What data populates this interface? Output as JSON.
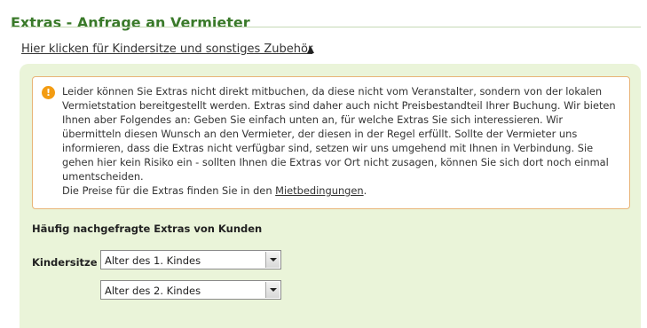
{
  "section": {
    "title": "Extras - Anfrage an Vermieter"
  },
  "toggle": {
    "label": "Hier klicken für Kindersitze und sonstiges Zubehör",
    "icon": "triangle-up-icon"
  },
  "notice": {
    "icon": "info-icon",
    "icon_glyph": "!",
    "paragraph": "Leider können Sie Extras nicht direkt mitbuchen, da diese nicht vom Veranstalter, sondern von der lokalen Vermietstation bereitgestellt werden. Extras sind daher auch nicht Preisbestandteil Ihrer Buchung. Wir bieten Ihnen aber Folgendes an: Geben Sie einfach unten an, für welche Extras Sie sich interessieren. Wir übermitteln diesen Wunsch an den Vermieter, der diesen in der Regel erfüllt. Sollte der Vermieter uns informieren, dass die Extras nicht verfügbar sind, setzen wir uns umgehend mit Ihnen in Verbindung. Sie gehen hier kein Risiko ein - sollten Ihnen die Extras vor Ort nicht zusagen, können Sie sich dort noch einmal umentscheiden.",
    "prices_prefix": "Die Preise für die Extras finden Sie in den ",
    "prices_link": "Mietbedingungen",
    "prices_suffix": "."
  },
  "extras": {
    "heading": "Häufig nachgefragte Extras von Kunden",
    "kindersitze_label": "Kindersitze",
    "child1_value": "Alter des 1. Kindes",
    "child2_value": "Alter des 2. Kindes"
  },
  "colors": {
    "title_green": "#3a7a2a",
    "panel_bg": "#eaf4d9",
    "notice_border": "#e8b477",
    "info_orange": "#f39c12"
  }
}
